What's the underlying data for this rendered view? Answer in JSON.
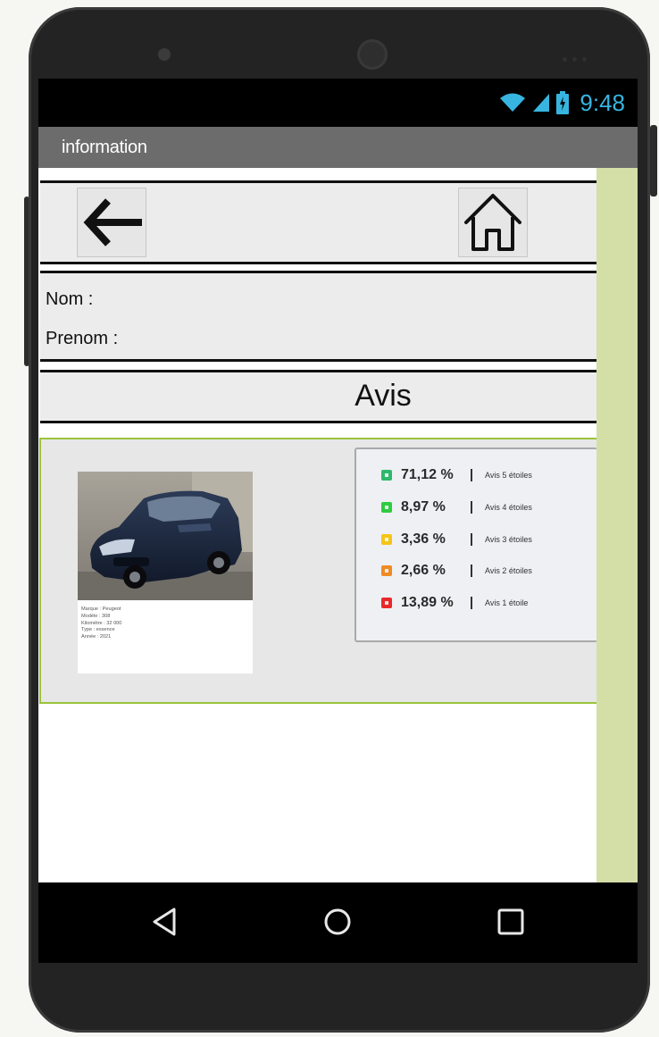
{
  "status_bar": {
    "time": "9:48"
  },
  "app_bar": {
    "title": "information"
  },
  "nav": {
    "back_icon": "arrow-left-icon",
    "home_icon": "home-icon"
  },
  "person": {
    "nom_label": "Nom :",
    "prenom_label": "Prenom :"
  },
  "section": {
    "title": "Avis"
  },
  "car": {
    "details": [
      "Marque : Peugeot",
      "Modèle : 308",
      "Kilomètre : 32 000",
      "Type : essence",
      "Année : 2021"
    ]
  },
  "ratings": [
    {
      "percent": "71,12 %",
      "label": "Avis 5 étoiles",
      "color": "#2fb86b"
    },
    {
      "percent": "8,97 %",
      "label": "Avis 4 étoiles",
      "color": "#2ecc40"
    },
    {
      "percent": "3,36 %",
      "label": "Avis 3 étoiles",
      "color": "#f5c518"
    },
    {
      "percent": "2,66 %",
      "label": "Avis 2 étoiles",
      "color": "#f08a24"
    },
    {
      "percent": "13,89 %",
      "label": "Avis 1 étoile",
      "color": "#e8282b"
    }
  ],
  "colors": {
    "accent_border": "#9bc33c",
    "right_strip": "#d4dfa8",
    "status_text": "#37b5e0",
    "app_bar": "#6c6c6c"
  },
  "system_nav": {
    "back": "triangle-back-icon",
    "home": "circle-home-icon",
    "recents": "square-recents-icon"
  }
}
